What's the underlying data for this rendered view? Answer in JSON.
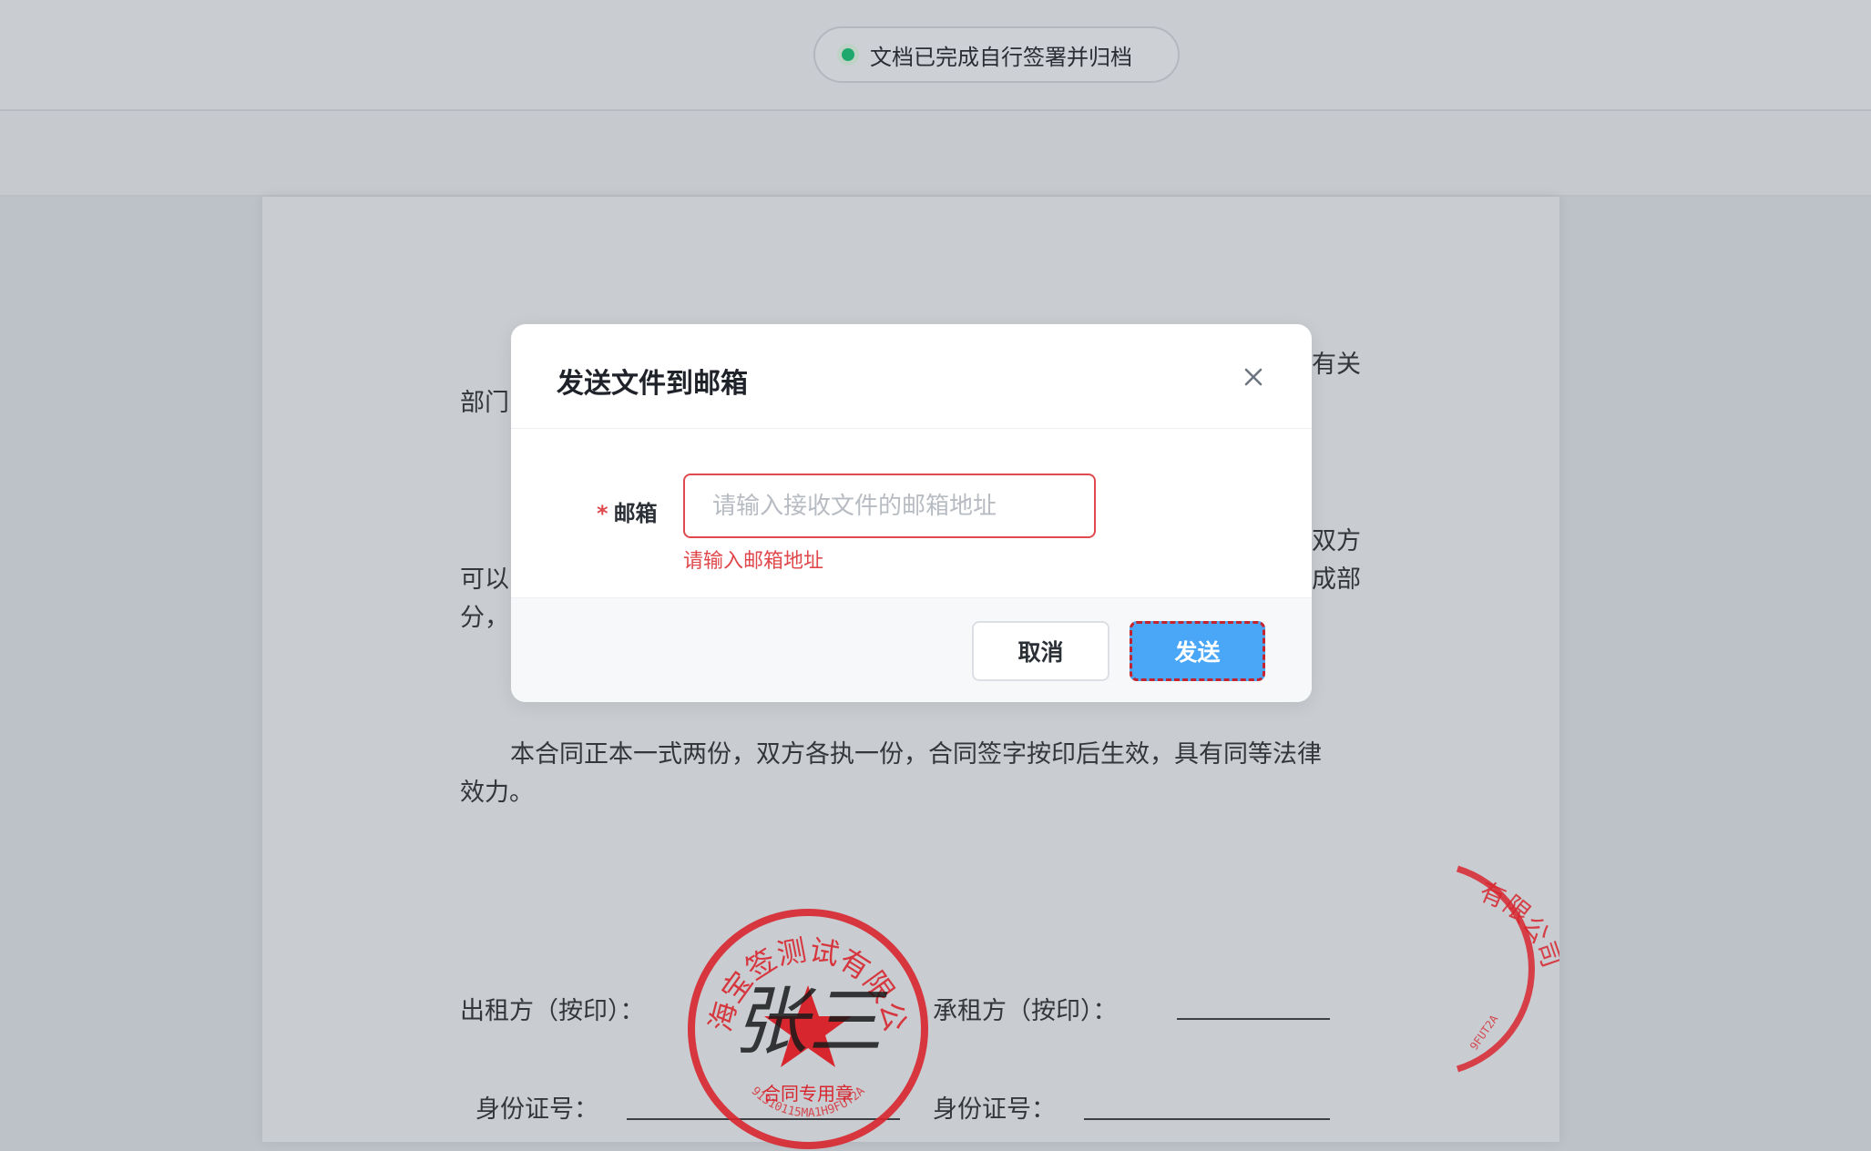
{
  "status_bar": {
    "text": "文档已完成自行签署并归档",
    "status_color": "#1fa86e"
  },
  "document": {
    "fragments": {
      "top_right": "有关",
      "dept": "部门",
      "right_mid1": "双方",
      "left_mid1": "可以",
      "right_mid2": "成部",
      "left_mid2": "分，"
    },
    "paragraph_line1": "本合同正本一式两份，双方各执一份，合同签字按印后生效，具有同等法律",
    "paragraph_line2": "效力。",
    "lessor_label": "出租方（按印）：",
    "lessee_label": "承租方（按印）：",
    "id_label_left": "身份证号：",
    "id_label_right": "身份证号："
  },
  "stamp_main": {
    "arc_text": "上海宝签测试有限公司",
    "center_text": "合同专用章",
    "bottom_code": "91310115MA1H9FUT2A",
    "signature": "张三",
    "color": "#d8262f"
  },
  "stamp_edge": {
    "arc_text": "有限公司",
    "bottom_code": "9FUT2A",
    "color": "#d8262f"
  },
  "dialog": {
    "title": "发送文件到邮箱",
    "field_label": "邮箱",
    "required_mark": "*",
    "input_placeholder": "请输入接收文件的邮箱地址",
    "input_value": "",
    "error_message": "请输入邮箱地址",
    "cancel_label": "取消",
    "send_label": "发送",
    "primary_color": "#4aa6f7",
    "error_color": "#e0484b"
  }
}
